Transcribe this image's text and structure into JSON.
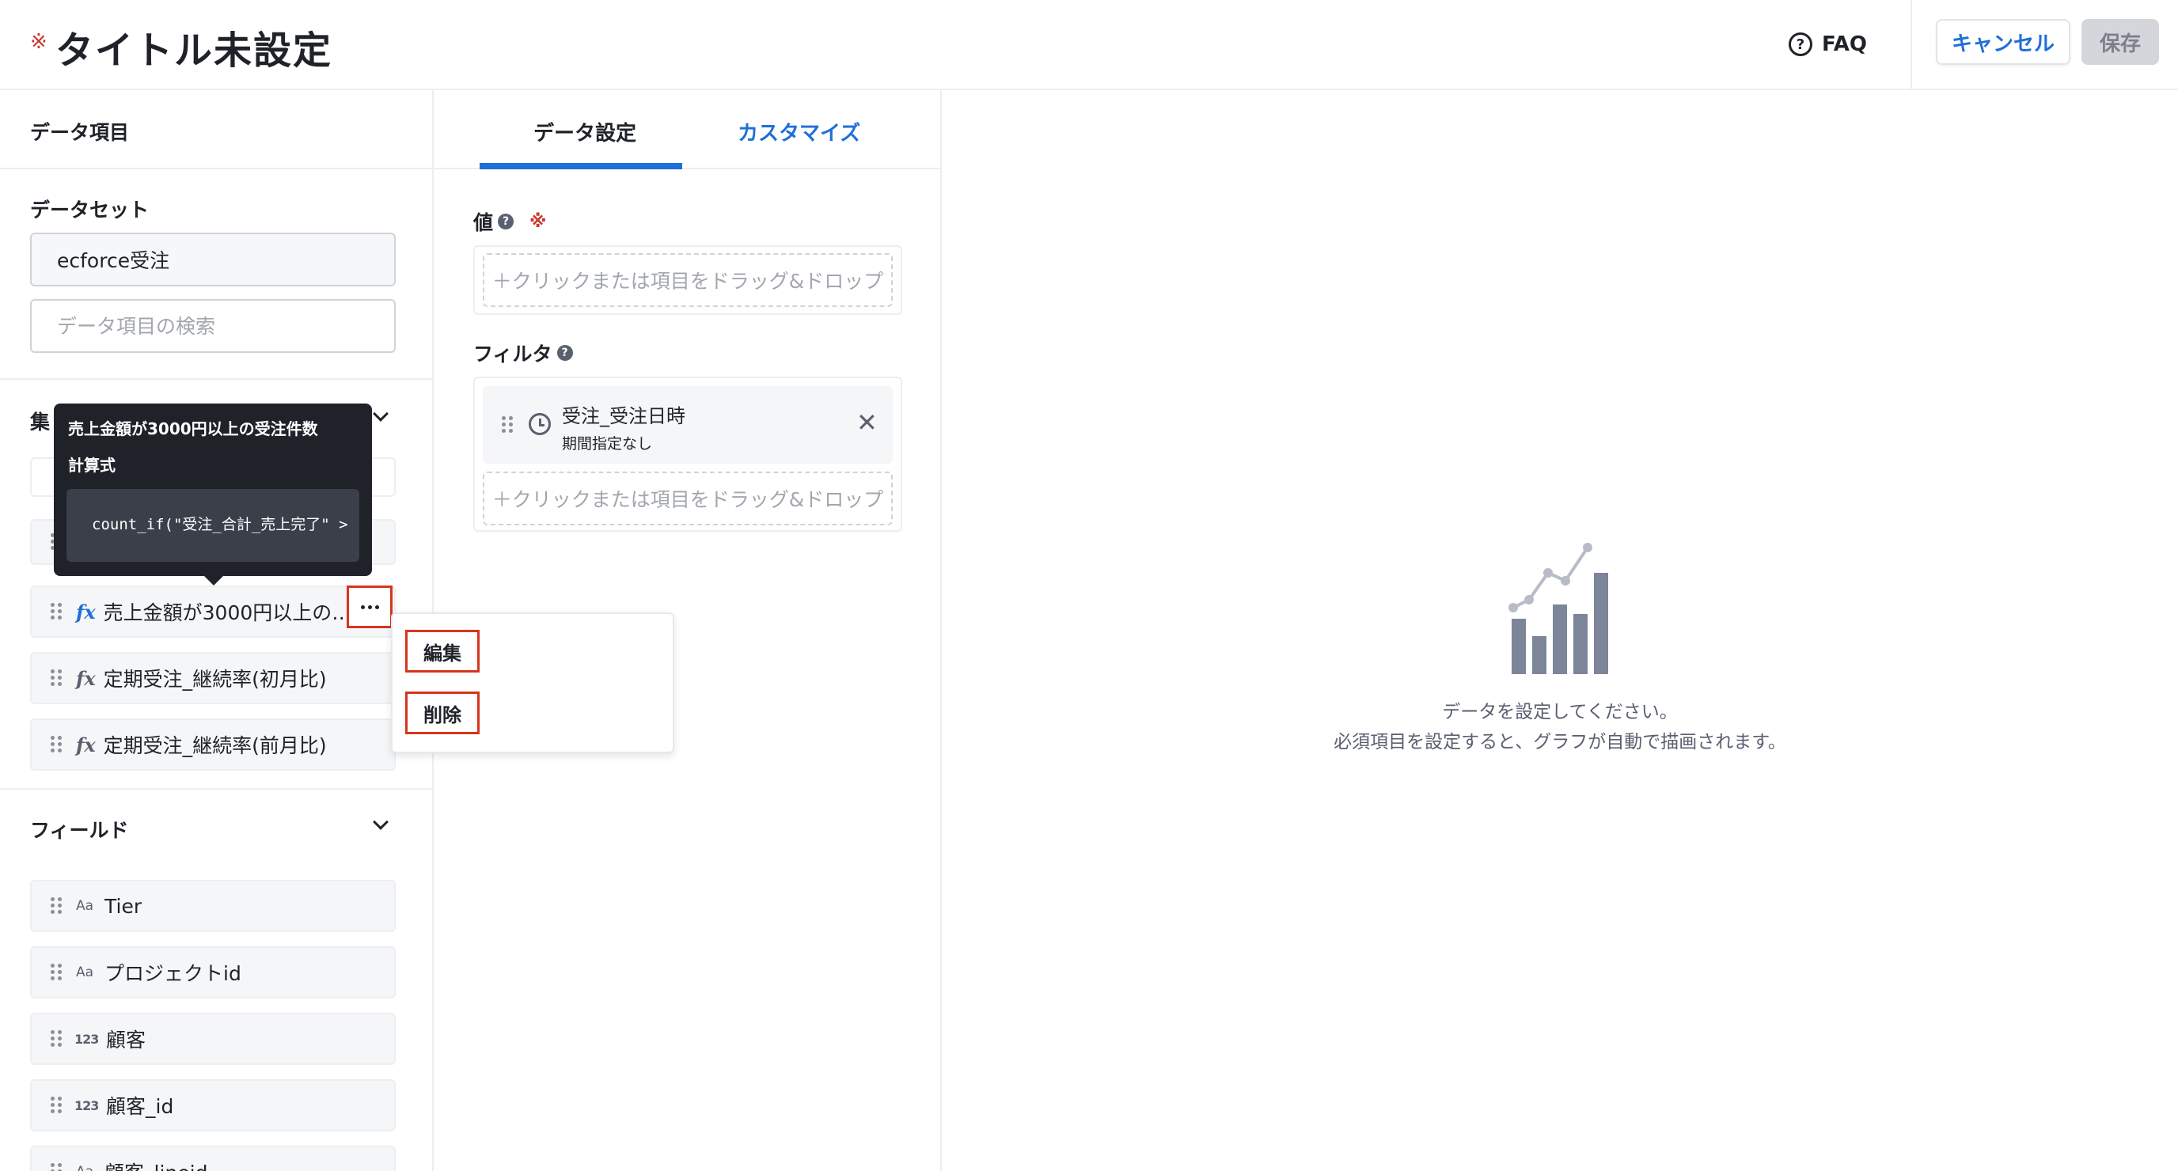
{
  "header": {
    "required_mark": "※",
    "title": "タイトル未設定",
    "faq_label": "FAQ",
    "cancel_label": "キャンセル",
    "save_label": "保存"
  },
  "left": {
    "heading": "データ項目",
    "dataset_label": "データセット",
    "dataset_value": "ecforce受注",
    "search_placeholder": "データ項目の検索",
    "aggregates_label": "集",
    "aggregates": [
      {
        "label": "売上金額が3000円以上の…",
        "type": "fx",
        "state": "selected"
      },
      {
        "label": "定期受注_継続率(初月比)",
        "type": "fx",
        "state": "normal"
      },
      {
        "label": "定期受注_継続率(前月比)",
        "type": "fx",
        "state": "normal"
      }
    ],
    "fields_label": "フィールド",
    "fields": [
      {
        "label": "Tier",
        "type": "Aa"
      },
      {
        "label": "プロジェクトid",
        "type": "Aa"
      },
      {
        "label": "顧客",
        "type": "123"
      },
      {
        "label": "顧客_id",
        "type": "123"
      },
      {
        "label": "顧客_lineid",
        "type": "Aa"
      }
    ]
  },
  "tooltip": {
    "title": "売上金額が3000円以上の受注件数",
    "subtitle": "計算式",
    "formula": "count_if(\"受注_合計_売上完了\" >"
  },
  "context_menu": {
    "edit": "編集",
    "delete": "削除"
  },
  "middle": {
    "tab_data": "データ設定",
    "tab_customize": "カスタマイズ",
    "value_label": "値",
    "value_required": "※",
    "drop_hint": "＋クリックまたは項目をドラッグ&ドロップ",
    "filter_label": "フィルタ",
    "filter_item_title": "受注_受注日時",
    "filter_item_sub": "期間指定なし"
  },
  "right": {
    "empty_line1": "データを設定してください。",
    "empty_line2": "必須項目を設定すると、グラフが自動で描画されます。"
  },
  "colors": {
    "accent": "#1f6fd8",
    "required": "#c8372d",
    "highlight_border": "#d5361d",
    "tooltip_bg": "#1f2229",
    "empty_icon": "#7d8599"
  }
}
